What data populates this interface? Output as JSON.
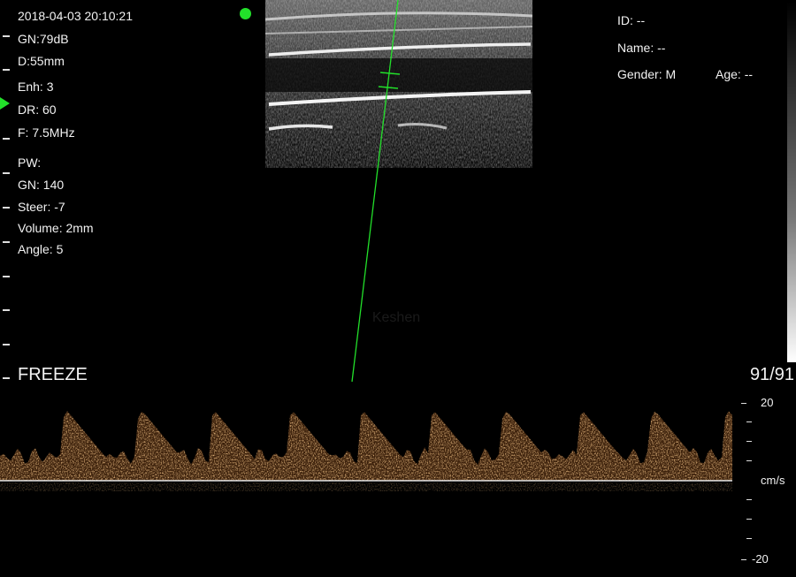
{
  "exam": {
    "datetime": "2018-04-03 20:10:21",
    "gain": "GN:79dB",
    "depth": "D:55mm",
    "enhancement": "Enh: 3",
    "dynamic_range": "DR: 60",
    "frequency": "F: 7.5MHz"
  },
  "pw": {
    "title": "PW:",
    "gain": "GN: 140",
    "steer": "Steer: -7",
    "volume": "Volume: 2mm",
    "angle": "Angle: 5"
  },
  "patient": {
    "id": "ID: --",
    "name": "Name: --",
    "gender": "Gender: M",
    "age": "Age: --"
  },
  "status": {
    "freeze_label": "FREEZE",
    "frame_counter": "91/91"
  },
  "velocity_scale": {
    "max_label": "20",
    "min_label": "-20",
    "unit": "cm/s"
  },
  "watermark": "Keshen",
  "colors": {
    "accent": "#22e02a",
    "spectrum": "#d9843a",
    "text": "#f2f2f2"
  }
}
